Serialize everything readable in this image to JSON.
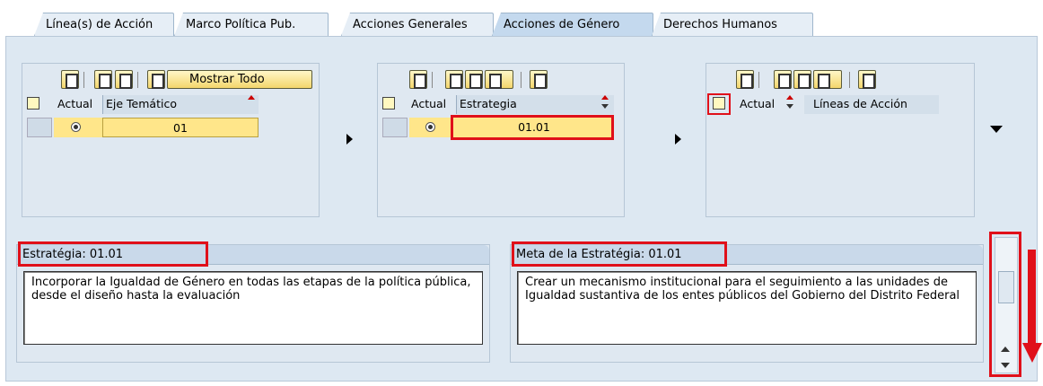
{
  "tabs": [
    {
      "label": "Línea(s) de Acción"
    },
    {
      "label": "Marco Política Pub."
    },
    {
      "label": "Acciones Generales"
    },
    {
      "label": "Acciones de Género"
    },
    {
      "label": "Derechos Humanos"
    }
  ],
  "active_tab": "Acciones de Género",
  "block1": {
    "show_all_label": "Mostrar Todo",
    "col_actual": "Actual",
    "col_main": "Eje Temático",
    "row_value": "01"
  },
  "block2": {
    "col_actual": "Actual",
    "col_main": "Estrategia",
    "row_value": "01.01"
  },
  "block3": {
    "col_actual": "Actual",
    "col_main": "Líneas de Acción"
  },
  "strategy": {
    "title": "Estratégia: 01.01",
    "text": "Incorporar la Igualdad de Género en todas las etapas de la política pública, desde el diseño hasta la evaluación"
  },
  "goal": {
    "title": "Meta de la Estratégia: 01.01",
    "text": "Crear un mecanismo institucional para el seguimiento a las unidades de Igualdad sustantiva de los entes públicos del Gobierno del Distrito Federal"
  },
  "colors": {
    "highlight": "#e0101a",
    "selected_cell": "#ffe68a",
    "panel": "#dde8f2"
  }
}
